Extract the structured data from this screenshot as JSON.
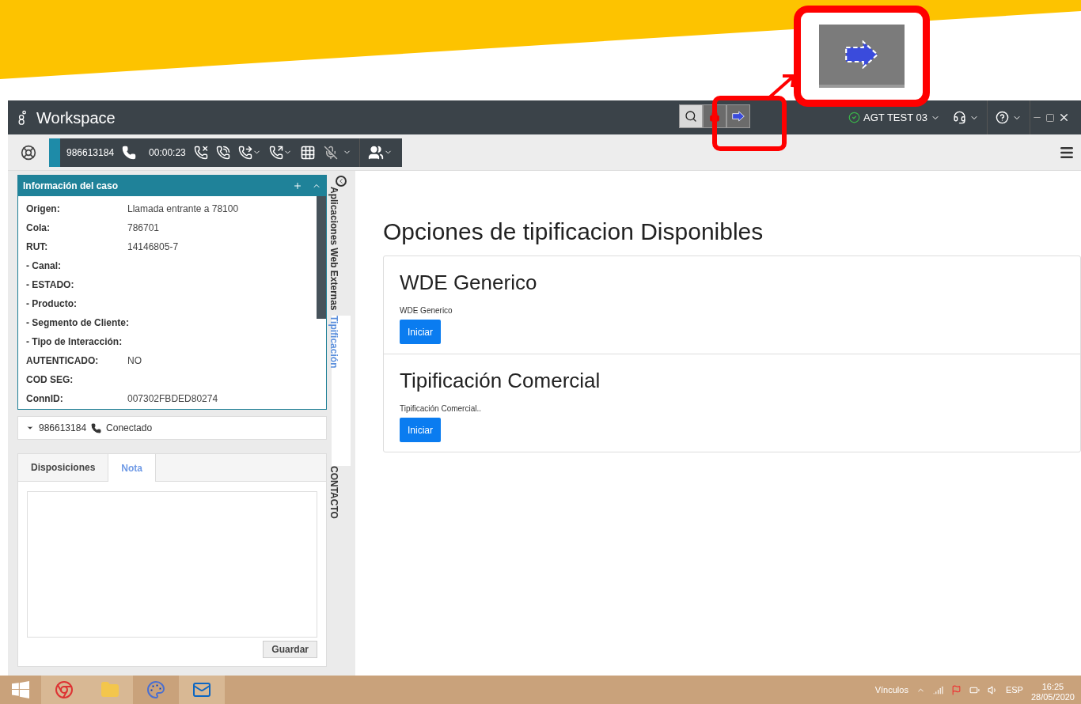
{
  "window": {
    "title": "Workspace",
    "agent": "AGT TEST 03"
  },
  "call_bar": {
    "number": "986613184",
    "timer": "00:00:23"
  },
  "case_panel": {
    "title": "Información del caso",
    "rows": [
      {
        "label": "Origen:",
        "value": "Llamada entrante a 78100"
      },
      {
        "label": "Cola:",
        "value": "786701"
      },
      {
        "label": "RUT:",
        "value": "14146805-7"
      },
      {
        "label": "- Canal:"
      },
      {
        "label": "- ESTADO:"
      },
      {
        "label": "- Producto:"
      },
      {
        "label": "- Segmento de Cliente:"
      },
      {
        "label": "- Tipo de Interacción:"
      },
      {
        "label": "AUTENTICADO:",
        "value": "NO"
      },
      {
        "label": "COD SEG:"
      },
      {
        "label": "ConnID:",
        "value": "007302FBDED80274"
      }
    ]
  },
  "interaction": {
    "number": "986613184",
    "status": "Conectado"
  },
  "side_tabs": [
    {
      "label": "Aplicaciones Web Externas",
      "selected": false
    },
    {
      "label": "Tipificación",
      "selected": true
    },
    {
      "label": "CONTACTO",
      "selected": false
    }
  ],
  "note_tabs": [
    {
      "label": "Disposiciones",
      "selected": false
    },
    {
      "label": "Nota",
      "selected": true
    }
  ],
  "save_button": "Guardar",
  "main": {
    "heading": "Opciones de tipificacion Disponibles",
    "options": [
      {
        "title": "WDE Generico",
        "description": "WDE Generico",
        "button": "Iniciar"
      },
      {
        "title": "Tipificación Comercial",
        "description": "Tipificación Comercial..",
        "button": "Iniciar"
      }
    ]
  },
  "taskbar": {
    "links": "Vínculos",
    "language": "ESP",
    "time": "16:25",
    "date": "28/05/2020"
  }
}
